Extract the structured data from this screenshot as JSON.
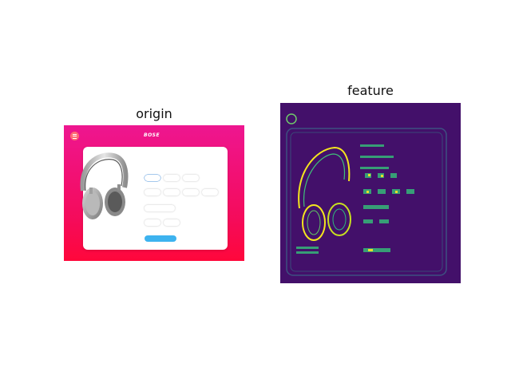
{
  "panels": {
    "left_title": "origin",
    "right_title": "feature"
  },
  "product_page": {
    "brand": "BOSE",
    "tabs": [
      "",
      "",
      "",
      ""
    ],
    "active_tab_index": 2,
    "options_row1": [
      "",
      "",
      ""
    ],
    "options_row2": [
      "",
      "",
      "",
      ""
    ],
    "options_row3": [
      ""
    ],
    "options_row4": [
      "",
      ""
    ],
    "price_lines": [
      "",
      ""
    ],
    "buy_label": "",
    "colors": {
      "gradient_top": "#ee1690",
      "gradient_bottom": "#ff073b",
      "accent": "#e8133d",
      "button": "#3db3ef"
    },
    "icons": [
      "menu-icon",
      "headphones-image"
    ]
  },
  "feature_map": {
    "colormap": "viridis",
    "background": "#43106a",
    "highlight": "#f4e61e"
  }
}
